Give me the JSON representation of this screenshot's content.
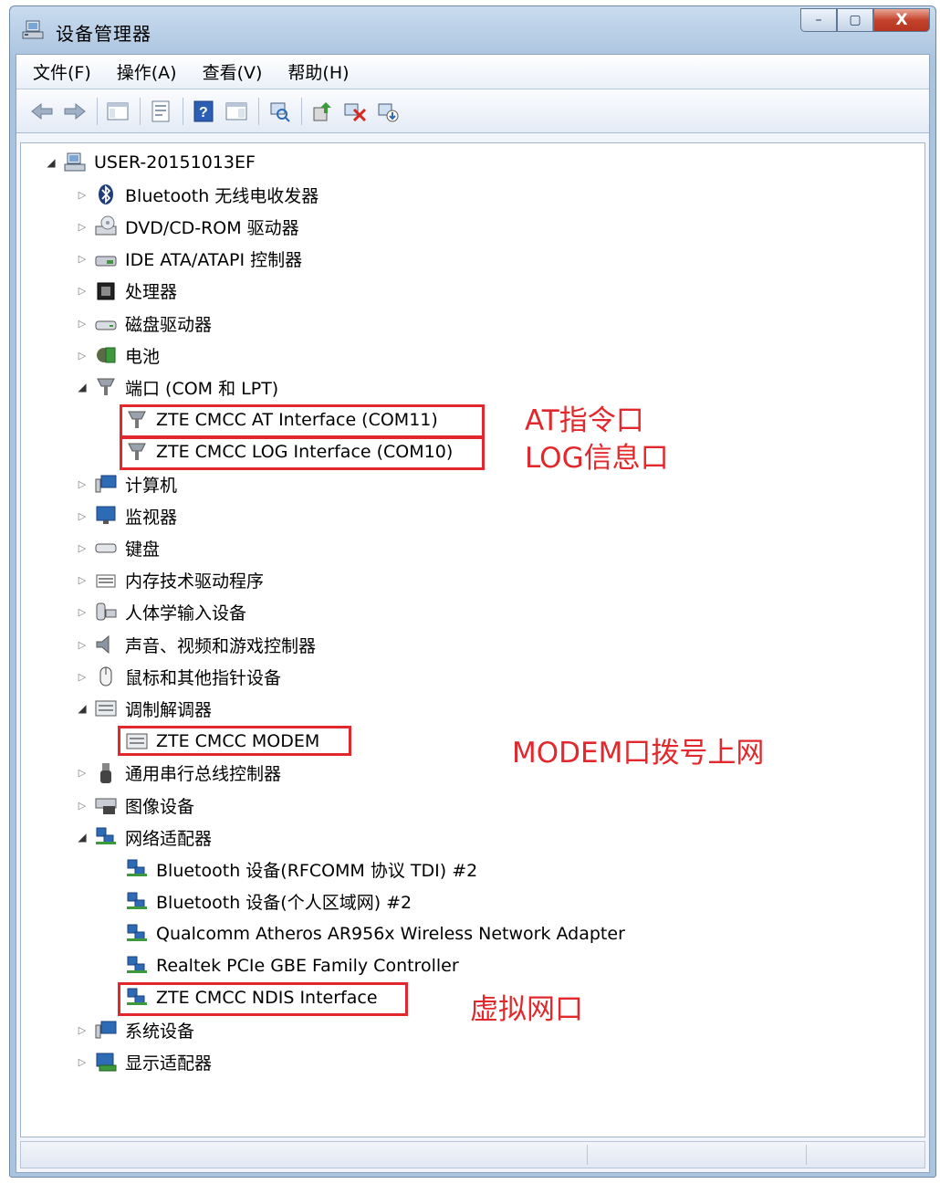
{
  "window": {
    "title": "设备管理器"
  },
  "window_controls": {
    "minimize": "–",
    "maximize": "▢",
    "close": "X"
  },
  "menu": [
    "文件(F)",
    "操作(A)",
    "查看(V)",
    "帮助(H)"
  ],
  "toolbar": {
    "buttons": [
      "back-icon",
      "forward-icon",
      "show-hide-tree-icon",
      "properties-icon",
      "help-icon",
      "action-pane-icon",
      "scan-hardware-icon",
      "update-driver-icon",
      "disable-device-icon",
      "uninstall-device-icon"
    ],
    "help_glyph": "?"
  },
  "tree": {
    "root": "USER-20151013EF",
    "nodes": [
      {
        "label": "Bluetooth 无线电收发器",
        "icon": "bluetooth-icon",
        "expanded": false
      },
      {
        "label": "DVD/CD-ROM 驱动器",
        "icon": "dvd-drive-icon",
        "expanded": false
      },
      {
        "label": "IDE ATA/ATAPI 控制器",
        "icon": "ide-controller-icon",
        "expanded": false
      },
      {
        "label": "处理器",
        "icon": "processor-icon",
        "expanded": false
      },
      {
        "label": "磁盘驱动器",
        "icon": "disk-drive-icon",
        "expanded": false
      },
      {
        "label": "电池",
        "icon": "battery-icon",
        "expanded": false
      },
      {
        "label": "端口 (COM 和 LPT)",
        "icon": "port-icon",
        "expanded": true,
        "children": [
          "ZTE CMCC AT Interface (COM11)",
          "ZTE CMCC LOG Interface (COM10)"
        ]
      },
      {
        "label": "计算机",
        "icon": "computer-icon",
        "expanded": false
      },
      {
        "label": "监视器",
        "icon": "monitor-icon",
        "expanded": false
      },
      {
        "label": "键盘",
        "icon": "keyboard-icon",
        "expanded": false
      },
      {
        "label": "内存技术驱动程序",
        "icon": "memory-icon",
        "expanded": false
      },
      {
        "label": "人体学输入设备",
        "icon": "hid-icon",
        "expanded": false
      },
      {
        "label": "声音、视频和游戏控制器",
        "icon": "sound-icon",
        "expanded": false
      },
      {
        "label": "鼠标和其他指针设备",
        "icon": "mouse-icon",
        "expanded": false
      },
      {
        "label": "调制解调器",
        "icon": "modem-icon",
        "expanded": true,
        "children": [
          "ZTE CMCC MODEM"
        ]
      },
      {
        "label": "通用串行总线控制器",
        "icon": "usb-icon",
        "expanded": false
      },
      {
        "label": "图像设备",
        "icon": "imaging-icon",
        "expanded": false
      },
      {
        "label": "网络适配器",
        "icon": "network-adapter-icon",
        "expanded": true,
        "children": [
          "Bluetooth 设备(RFCOMM 协议 TDI) #2",
          "Bluetooth 设备(个人区域网) #2",
          "Qualcomm Atheros AR956x Wireless Network Adapter",
          "Realtek PCIe GBE Family Controller",
          "ZTE CMCC NDIS Interface"
        ]
      },
      {
        "label": "系统设备",
        "icon": "system-devices-icon",
        "expanded": false
      },
      {
        "label": "显示适配器",
        "icon": "display-adapter-icon",
        "expanded": false
      }
    ]
  },
  "annotations": {
    "at": "AT指令口",
    "log": "LOG信息口",
    "modem": "MODEM口拨号上网",
    "ndis": "虚拟网口"
  },
  "colors": {
    "annotation": "#e2282c",
    "title_gradient": "#b4cbe3"
  }
}
